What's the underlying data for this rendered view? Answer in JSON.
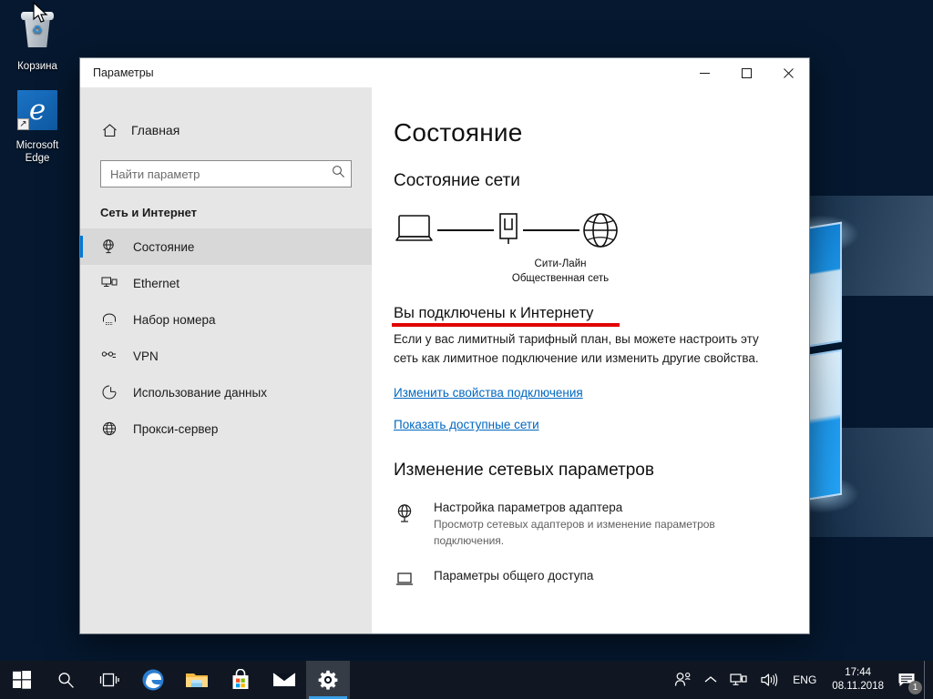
{
  "desktop": {
    "icons": [
      {
        "name": "recycle-bin",
        "label": "Корзина"
      },
      {
        "name": "microsoft-edge",
        "label": "Microsoft",
        "label2": "Edge"
      }
    ]
  },
  "window": {
    "title": "Параметры",
    "controls": {
      "minimize": "—",
      "maximize": "☐",
      "close": "✕"
    }
  },
  "sidebar": {
    "home_label": "Главная",
    "search": {
      "placeholder": "Найти параметр",
      "value": ""
    },
    "category": "Сеть и Интернет",
    "items": [
      {
        "label": "Состояние",
        "icon": "globe-monitor-icon",
        "selected": true
      },
      {
        "label": "Ethernet",
        "icon": "ethernet-icon",
        "selected": false
      },
      {
        "label": "Набор номера",
        "icon": "dialup-icon",
        "selected": false
      },
      {
        "label": "VPN",
        "icon": "vpn-icon",
        "selected": false
      },
      {
        "label": "Использование данных",
        "icon": "data-usage-icon",
        "selected": false
      },
      {
        "label": "Прокси-сервер",
        "icon": "proxy-globe-icon",
        "selected": false
      }
    ]
  },
  "content": {
    "page_title": "Состояние",
    "network_status_heading": "Состояние сети",
    "diagram": {
      "device_icon": "laptop-icon",
      "network_icon": "ethernet-port-icon",
      "internet_icon": "globe-icon",
      "network_name": "Сити-Лайн",
      "network_type": "Общественная сеть"
    },
    "status_line": "Вы подключены к Интернету",
    "status_description": "Если у вас лимитный тарифный план, вы можете настроить эту сеть как лимитное подключение или изменить другие свойства.",
    "links": [
      "Изменить свойства подключения",
      "Показать доступные сети"
    ],
    "change_heading": "Изменение сетевых параметров",
    "options": [
      {
        "icon": "adapter-globe-icon",
        "title": "Настройка параметров адаптера",
        "subtitle": "Просмотр сетевых адаптеров и изменение параметров подключения."
      },
      {
        "icon": "sharing-icon",
        "title": "Параметры общего доступа",
        "subtitle": ""
      }
    ],
    "annotation_color": "#e00000"
  },
  "taskbar": {
    "buttons": [
      {
        "name": "start-button",
        "icon": "windows-logo-icon"
      },
      {
        "name": "search-button",
        "icon": "search-icon"
      },
      {
        "name": "task-view-button",
        "icon": "task-view-icon"
      },
      {
        "name": "edge-button",
        "icon": "edge-icon"
      },
      {
        "name": "file-explorer-button",
        "icon": "folder-icon"
      },
      {
        "name": "microsoft-store-button",
        "icon": "store-bag-icon"
      },
      {
        "name": "mail-button",
        "icon": "envelope-icon"
      },
      {
        "name": "settings-button",
        "icon": "gear-icon",
        "active": true
      }
    ],
    "tray": {
      "people_icon": "people-icon",
      "chevron_icon": "chevron-up-icon",
      "network_icon": "network-icon",
      "volume_icon": "speaker-icon",
      "language": "ENG",
      "time": "17:44",
      "date": "08.11.2018",
      "notification_icon": "action-center-icon",
      "notification_count": "1"
    }
  },
  "colors": {
    "accent": "#0078d7",
    "link": "#0067c0",
    "sidebar_bg": "#e6e6e6",
    "taskbar_bg": "#101722",
    "annotation_red": "#e00000"
  }
}
